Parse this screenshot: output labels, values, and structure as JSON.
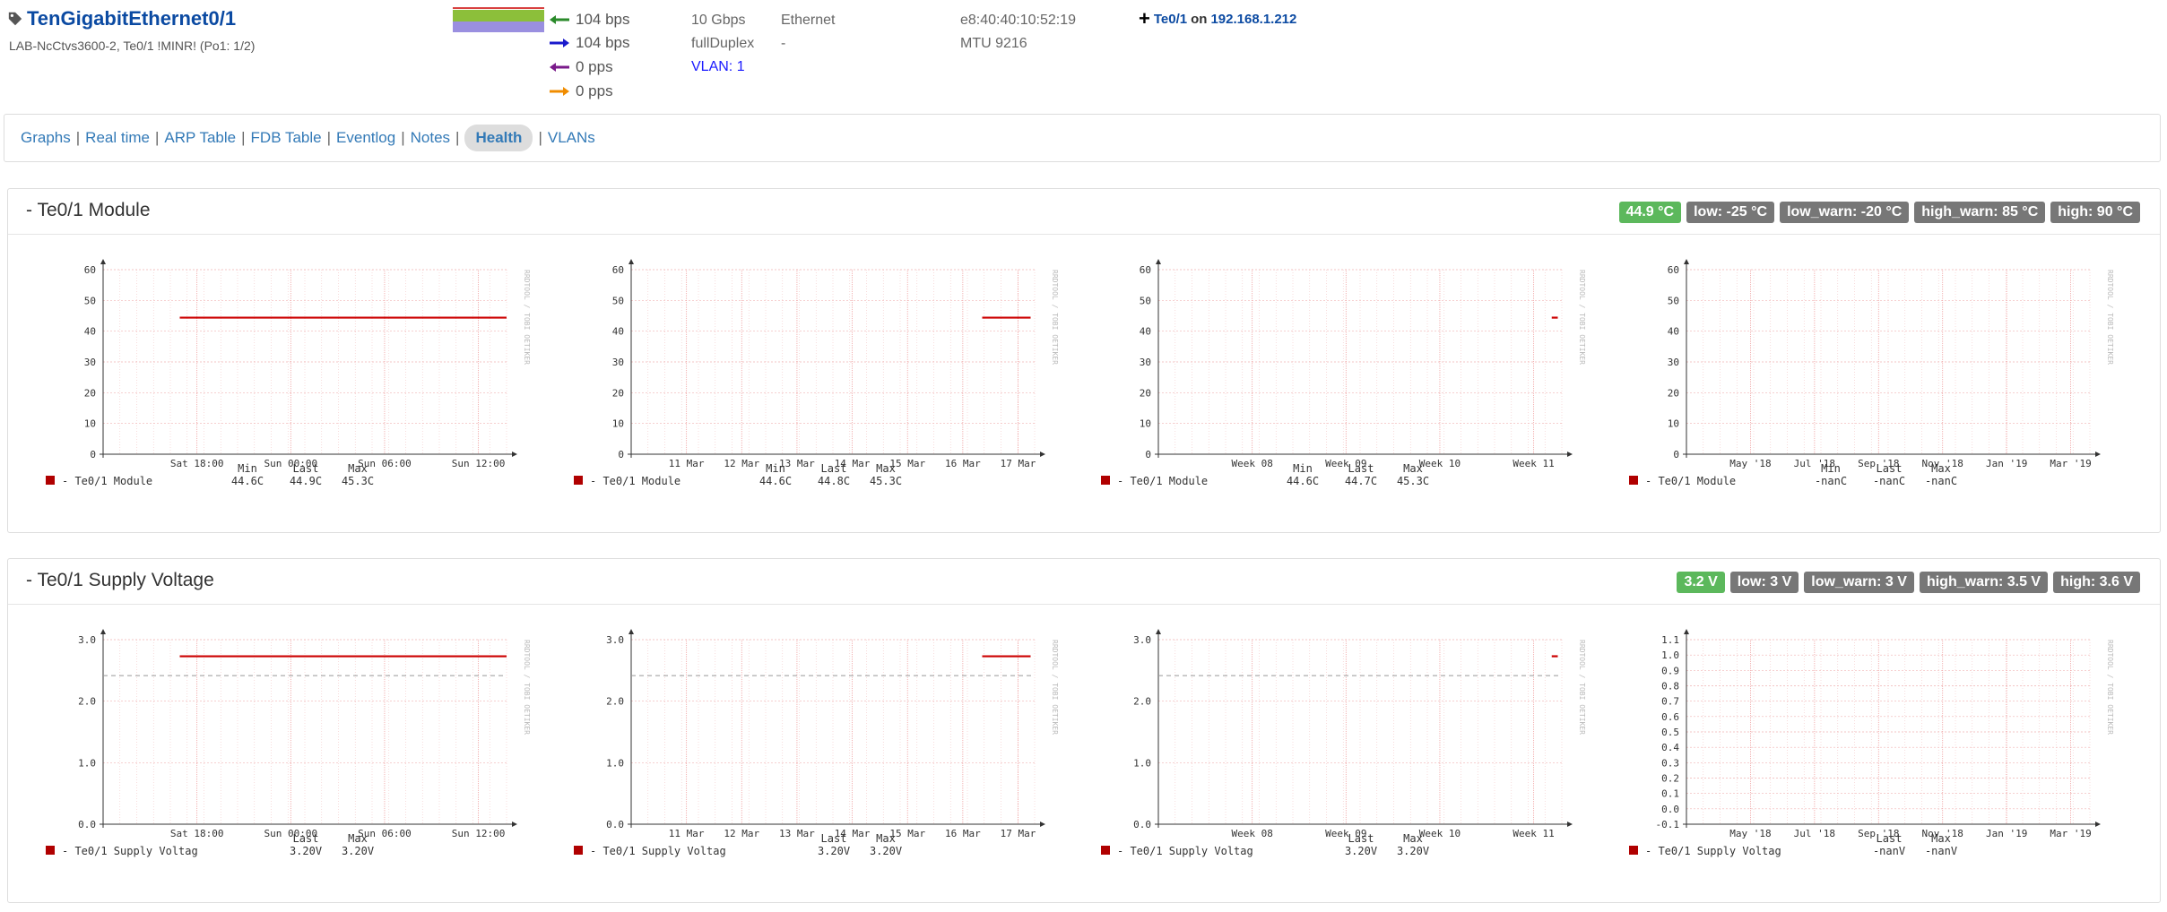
{
  "port": {
    "name": "TenGigabitEthernet0/1",
    "subtitle": "LAB-NcCtvs3600-2, Te0/1 !MINR! (Po1: 1/2)",
    "in_rate": "104 bps",
    "out_rate": "104 bps",
    "in_pps": "0 pps",
    "out_pps": "0 pps",
    "speed": "10 Gbps",
    "duplex": "fullDuplex",
    "vlan": "VLAN: 1",
    "type": "Ethernet",
    "type2": "-",
    "mac": "e8:40:40:10:52:19",
    "mtu": "MTU 9216",
    "neighbour_port": "Te0/1",
    "neighbour_on": "on",
    "neighbour_ip": "192.168.1.212"
  },
  "nav": {
    "tabs": [
      "Graphs",
      "Real time",
      "ARP Table",
      "FDB Table",
      "Eventlog",
      "Notes",
      "Health",
      "VLANs"
    ],
    "active": "Health"
  },
  "colors": {
    "ok": "#5cb85c",
    "badge": "#777777",
    "link": "#337ab7",
    "series": "#cc0000"
  },
  "sections": [
    {
      "title": "- Te0/1 Module",
      "badges": [
        "44.9 °C",
        "low: -25 °C",
        "low_warn: -20 °C",
        "high_warn: 85 °C",
        "high: 90 °C"
      ],
      "graphs": [
        {
          "yticks": [
            "60",
            "50",
            "40",
            "30",
            "20",
            "10",
            "0"
          ],
          "xticks": [
            "Sat 18:00",
            "Sun 00:00",
            "Sun 06:00",
            "Sun 12:00"
          ],
          "legend_name": "- Te0/1 Module",
          "heads": [
            "Min",
            "Last",
            "Max"
          ],
          "vals": [
            "44.6C",
            "44.9C",
            "45.3C"
          ],
          "watermark": "RRDTOOL / TOBI OETIKER"
        },
        {
          "yticks": [
            "60",
            "50",
            "40",
            "30",
            "20",
            "10",
            "0"
          ],
          "xticks": [
            "11 Mar",
            "12 Mar",
            "13 Mar",
            "14 Mar",
            "15 Mar",
            "16 Mar",
            "17 Mar"
          ],
          "legend_name": "- Te0/1 Module",
          "heads": [
            "Min",
            "Last",
            "Max"
          ],
          "vals": [
            "44.6C",
            "44.8C",
            "45.3C"
          ],
          "watermark": "RRDTOOL / TOBI OETIKER"
        },
        {
          "yticks": [
            "60",
            "50",
            "40",
            "30",
            "20",
            "10",
            "0"
          ],
          "xticks": [
            "Week 08",
            "Week 09",
            "Week 10",
            "Week 11"
          ],
          "legend_name": "- Te0/1 Module",
          "heads": [
            "Min",
            "Last",
            "Max"
          ],
          "vals": [
            "44.6C",
            "44.7C",
            "45.3C"
          ],
          "watermark": "RRDTOOL / TOBI OETIKER"
        },
        {
          "yticks": [
            "60",
            "50",
            "40",
            "30",
            "20",
            "10",
            "0"
          ],
          "xticks": [
            "May '18",
            "Jul '18",
            "Sep '18",
            "Nov '18",
            "Jan '19",
            "Mar '19"
          ],
          "legend_name": "- Te0/1 Module",
          "heads": [
            "Min",
            "Last",
            "Max"
          ],
          "vals": [
            "-nanC",
            "-nanC",
            "-nanC"
          ],
          "watermark": "RRDTOOL / TOBI OETIKER"
        }
      ]
    },
    {
      "title": "- Te0/1 Supply Voltage",
      "badges": [
        "3.2 V",
        "low: 3 V",
        "low_warn: 3 V",
        "high_warn: 3.5 V",
        "high: 3.6 V"
      ],
      "graphs": [
        {
          "yticks": [
            "3.0",
            "2.0",
            "1.0",
            "0.0"
          ],
          "xticks": [
            "Sat 18:00",
            "Sun 00:00",
            "Sun 06:00",
            "Sun 12:00"
          ],
          "legend_name": "- Te0/1 Supply Voltag",
          "heads": [
            "Last",
            "Max"
          ],
          "vals": [
            "3.20V",
            "3.20V"
          ],
          "watermark": "RRDTOOL / TOBI OETIKER"
        },
        {
          "yticks": [
            "3.0",
            "2.0",
            "1.0",
            "0.0"
          ],
          "xticks": [
            "11 Mar",
            "12 Mar",
            "13 Mar",
            "14 Mar",
            "15 Mar",
            "16 Mar",
            "17 Mar"
          ],
          "legend_name": "- Te0/1 Supply Voltag",
          "heads": [
            "Last",
            "Max"
          ],
          "vals": [
            "3.20V",
            "3.20V"
          ],
          "watermark": "RRDTOOL / TOBI OETIKER"
        },
        {
          "yticks": [
            "3.0",
            "2.0",
            "1.0",
            "0.0"
          ],
          "xticks": [
            "Week 08",
            "Week 09",
            "Week 10",
            "Week 11"
          ],
          "legend_name": "- Te0/1 Supply Voltag",
          "heads": [
            "Last",
            "Max"
          ],
          "vals": [
            "3.20V",
            "3.20V"
          ],
          "watermark": "RRDTOOL / TOBI OETIKER"
        },
        {
          "yticks": [
            "1.1",
            "1.0",
            "0.9",
            "0.8",
            "0.7",
            "0.6",
            "0.5",
            "0.4",
            "0.3",
            "0.2",
            "0.1",
            "0.0",
            "-0.1"
          ],
          "xticks": [
            "May '18",
            "Jul '18",
            "Sep '18",
            "Nov '18",
            "Jan '19",
            "Mar '19"
          ],
          "legend_name": "- Te0/1 Supply Voltag",
          "heads": [
            "Last",
            "Max"
          ],
          "vals": [
            "-nanV",
            "-nanV"
          ],
          "watermark": "RRDTOOL / TOBI OETIKER"
        }
      ]
    }
  ]
}
